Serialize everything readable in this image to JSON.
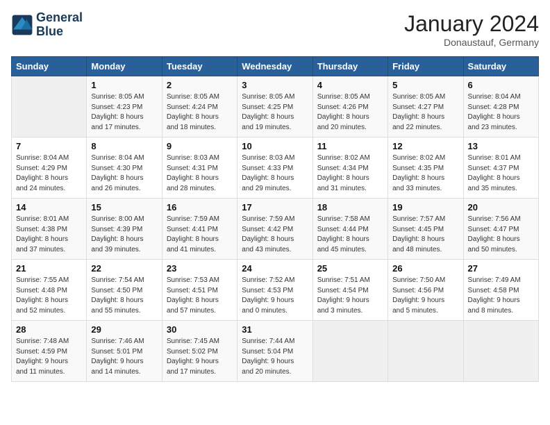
{
  "logo": {
    "line1": "General",
    "line2": "Blue"
  },
  "title": "January 2024",
  "location": "Donaustauf, Germany",
  "headers": [
    "Sunday",
    "Monday",
    "Tuesday",
    "Wednesday",
    "Thursday",
    "Friday",
    "Saturday"
  ],
  "weeks": [
    [
      {
        "day": "",
        "info": ""
      },
      {
        "day": "1",
        "info": "Sunrise: 8:05 AM\nSunset: 4:23 PM\nDaylight: 8 hours\nand 17 minutes."
      },
      {
        "day": "2",
        "info": "Sunrise: 8:05 AM\nSunset: 4:24 PM\nDaylight: 8 hours\nand 18 minutes."
      },
      {
        "day": "3",
        "info": "Sunrise: 8:05 AM\nSunset: 4:25 PM\nDaylight: 8 hours\nand 19 minutes."
      },
      {
        "day": "4",
        "info": "Sunrise: 8:05 AM\nSunset: 4:26 PM\nDaylight: 8 hours\nand 20 minutes."
      },
      {
        "day": "5",
        "info": "Sunrise: 8:05 AM\nSunset: 4:27 PM\nDaylight: 8 hours\nand 22 minutes."
      },
      {
        "day": "6",
        "info": "Sunrise: 8:04 AM\nSunset: 4:28 PM\nDaylight: 8 hours\nand 23 minutes."
      }
    ],
    [
      {
        "day": "7",
        "info": "Sunrise: 8:04 AM\nSunset: 4:29 PM\nDaylight: 8 hours\nand 24 minutes."
      },
      {
        "day": "8",
        "info": "Sunrise: 8:04 AM\nSunset: 4:30 PM\nDaylight: 8 hours\nand 26 minutes."
      },
      {
        "day": "9",
        "info": "Sunrise: 8:03 AM\nSunset: 4:31 PM\nDaylight: 8 hours\nand 28 minutes."
      },
      {
        "day": "10",
        "info": "Sunrise: 8:03 AM\nSunset: 4:33 PM\nDaylight: 8 hours\nand 29 minutes."
      },
      {
        "day": "11",
        "info": "Sunrise: 8:02 AM\nSunset: 4:34 PM\nDaylight: 8 hours\nand 31 minutes."
      },
      {
        "day": "12",
        "info": "Sunrise: 8:02 AM\nSunset: 4:35 PM\nDaylight: 8 hours\nand 33 minutes."
      },
      {
        "day": "13",
        "info": "Sunrise: 8:01 AM\nSunset: 4:37 PM\nDaylight: 8 hours\nand 35 minutes."
      }
    ],
    [
      {
        "day": "14",
        "info": "Sunrise: 8:01 AM\nSunset: 4:38 PM\nDaylight: 8 hours\nand 37 minutes."
      },
      {
        "day": "15",
        "info": "Sunrise: 8:00 AM\nSunset: 4:39 PM\nDaylight: 8 hours\nand 39 minutes."
      },
      {
        "day": "16",
        "info": "Sunrise: 7:59 AM\nSunset: 4:41 PM\nDaylight: 8 hours\nand 41 minutes."
      },
      {
        "day": "17",
        "info": "Sunrise: 7:59 AM\nSunset: 4:42 PM\nDaylight: 8 hours\nand 43 minutes."
      },
      {
        "day": "18",
        "info": "Sunrise: 7:58 AM\nSunset: 4:44 PM\nDaylight: 8 hours\nand 45 minutes."
      },
      {
        "day": "19",
        "info": "Sunrise: 7:57 AM\nSunset: 4:45 PM\nDaylight: 8 hours\nand 48 minutes."
      },
      {
        "day": "20",
        "info": "Sunrise: 7:56 AM\nSunset: 4:47 PM\nDaylight: 8 hours\nand 50 minutes."
      }
    ],
    [
      {
        "day": "21",
        "info": "Sunrise: 7:55 AM\nSunset: 4:48 PM\nDaylight: 8 hours\nand 52 minutes."
      },
      {
        "day": "22",
        "info": "Sunrise: 7:54 AM\nSunset: 4:50 PM\nDaylight: 8 hours\nand 55 minutes."
      },
      {
        "day": "23",
        "info": "Sunrise: 7:53 AM\nSunset: 4:51 PM\nDaylight: 8 hours\nand 57 minutes."
      },
      {
        "day": "24",
        "info": "Sunrise: 7:52 AM\nSunset: 4:53 PM\nDaylight: 9 hours\nand 0 minutes."
      },
      {
        "day": "25",
        "info": "Sunrise: 7:51 AM\nSunset: 4:54 PM\nDaylight: 9 hours\nand 3 minutes."
      },
      {
        "day": "26",
        "info": "Sunrise: 7:50 AM\nSunset: 4:56 PM\nDaylight: 9 hours\nand 5 minutes."
      },
      {
        "day": "27",
        "info": "Sunrise: 7:49 AM\nSunset: 4:58 PM\nDaylight: 9 hours\nand 8 minutes."
      }
    ],
    [
      {
        "day": "28",
        "info": "Sunrise: 7:48 AM\nSunset: 4:59 PM\nDaylight: 9 hours\nand 11 minutes."
      },
      {
        "day": "29",
        "info": "Sunrise: 7:46 AM\nSunset: 5:01 PM\nDaylight: 9 hours\nand 14 minutes."
      },
      {
        "day": "30",
        "info": "Sunrise: 7:45 AM\nSunset: 5:02 PM\nDaylight: 9 hours\nand 17 minutes."
      },
      {
        "day": "31",
        "info": "Sunrise: 7:44 AM\nSunset: 5:04 PM\nDaylight: 9 hours\nand 20 minutes."
      },
      {
        "day": "",
        "info": ""
      },
      {
        "day": "",
        "info": ""
      },
      {
        "day": "",
        "info": ""
      }
    ]
  ]
}
